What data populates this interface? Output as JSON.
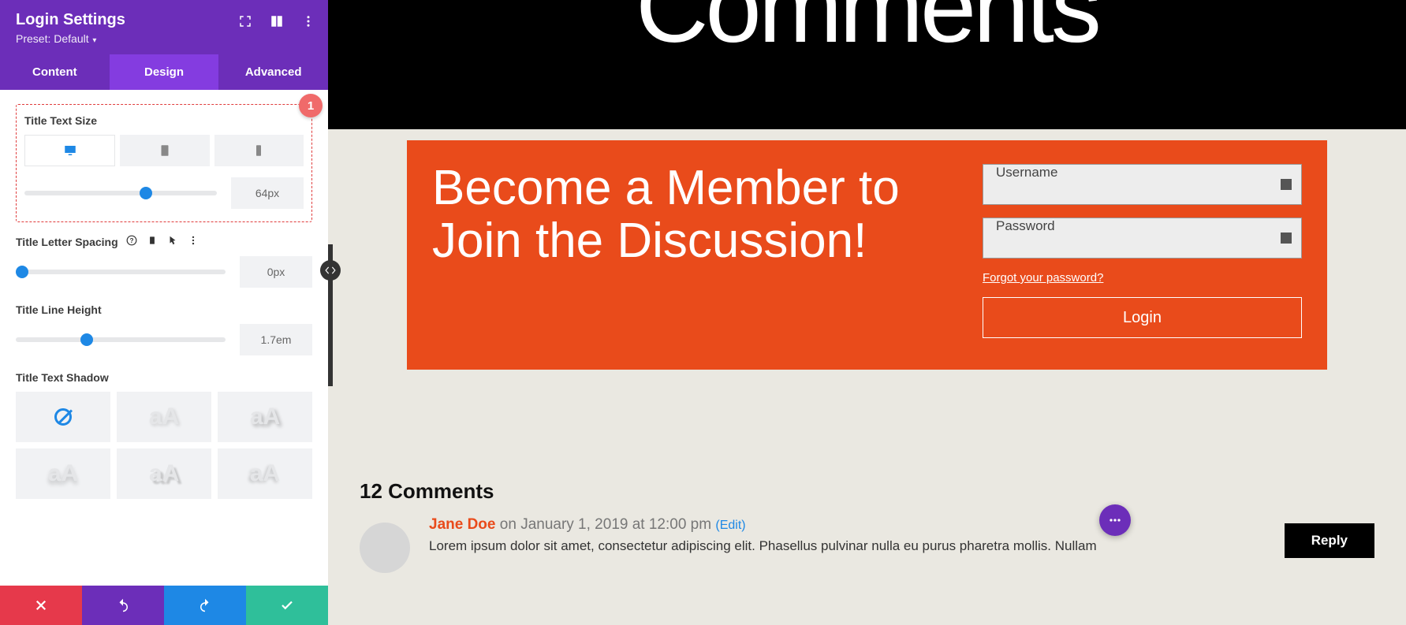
{
  "panel": {
    "title": "Login Settings",
    "preset_label": "Preset: Default",
    "tabs": [
      "Content",
      "Design",
      "Advanced"
    ],
    "active_tab": 1,
    "badge_number": "1",
    "title_text_size": {
      "label": "Title Text Size",
      "value": "64px",
      "slider_pct": 63
    },
    "title_letter_spacing": {
      "label": "Title Letter Spacing",
      "value": "0px",
      "slider_pct": 3
    },
    "title_line_height": {
      "label": "Title Line Height",
      "value": "1.7em",
      "slider_pct": 34
    },
    "title_text_shadow": {
      "label": "Title Text Shadow",
      "sample": "aA"
    }
  },
  "preview": {
    "hero_title": "Comments",
    "login": {
      "title": "Become a Member to Join the Discussion!",
      "username_placeholder": "Username",
      "password_placeholder": "Password",
      "forgot": "Forgot your password?",
      "button": "Login"
    },
    "comments": {
      "heading": "12 Comments",
      "items": [
        {
          "author": "Jane Doe",
          "date_prefix": " on ",
          "date": "January 1, 2019 at 12:00 pm",
          "edit": "(Edit)",
          "text": "Lorem ipsum dolor sit amet, consectetur adipiscing elit. Phasellus pulvinar nulla eu purus pharetra mollis. Nullam"
        }
      ],
      "reply": "Reply"
    }
  },
  "colors": {
    "purple": "#6C2EB9",
    "purple_light": "#843CE0",
    "orange": "#E94B1B",
    "blue": "#1E88E5",
    "green": "#2FBF9A",
    "red": "#E6394B"
  }
}
